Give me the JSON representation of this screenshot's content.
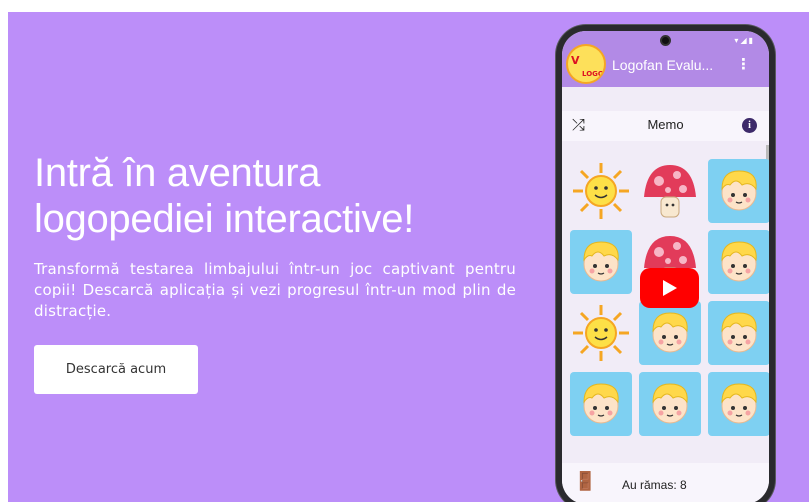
{
  "hero": {
    "headline_line1": "Intră în aventura",
    "headline_line2": "logopediei interactive!",
    "subtext": "Transformă testarea limbajului într-un joc captivant pentru copii! Descarcă aplicația și vezi progresul într-un mod plin de distracție.",
    "cta_label": "Descarcă acum"
  },
  "colors": {
    "background": "#bc8ef9",
    "phone_bar": "#b28ae6",
    "card_face": "#7ed0f2",
    "play_button": "#ff0000"
  },
  "phone": {
    "status_icons": "▾◢▮",
    "logo_letters": "V",
    "logo_brand": "LOGOFAN",
    "app_title": "Logofan Evalu...",
    "menu_icon": "kebab-menu-icon",
    "game": {
      "shuffle_icon": "shuffle-icon",
      "title": "Memo",
      "info_icon": "info-icon",
      "info_glyph": "i",
      "cards": [
        {
          "type": "sun"
        },
        {
          "type": "mushroom"
        },
        {
          "type": "boy"
        },
        {
          "type": "boy"
        },
        {
          "type": "mushroom"
        },
        {
          "type": "boy"
        },
        {
          "type": "sun"
        },
        {
          "type": "boy"
        },
        {
          "type": "boy"
        },
        {
          "type": "boy"
        },
        {
          "type": "boy"
        },
        {
          "type": "boy"
        }
      ],
      "exit_icon": "exit-door-icon",
      "remaining_text": "Au rămas: 8"
    },
    "video_overlay": "play-button-icon"
  }
}
